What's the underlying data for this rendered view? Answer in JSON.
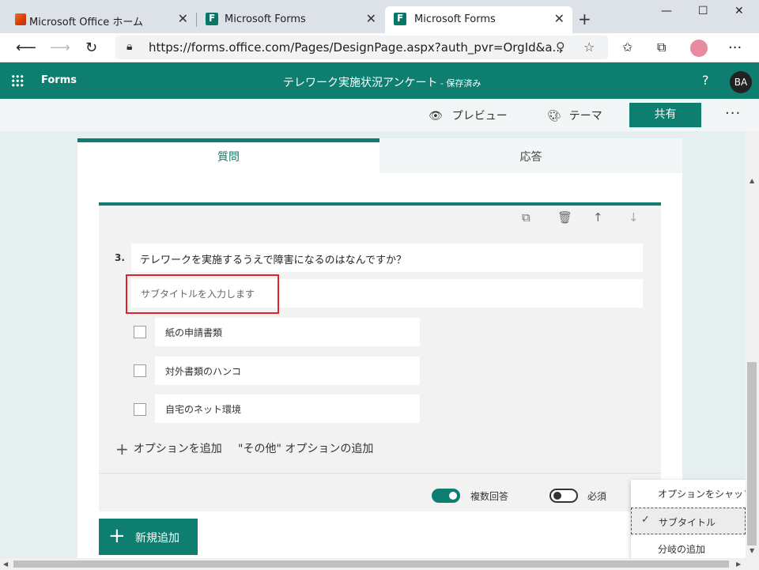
{
  "browser": {
    "tabs": [
      {
        "title": "Microsoft Office ホーム",
        "close": "✕"
      },
      {
        "title": "Microsoft Forms",
        "close": "✕"
      },
      {
        "title": "Microsoft Forms",
        "close": "✕"
      }
    ],
    "new_tab": "+",
    "window_controls": {
      "minimize": "—",
      "maximize": "☐",
      "close": "✕"
    },
    "url": "https://forms.office.com/Pages/DesignPage.aspx?auth_pvr=OrgId&a..."
  },
  "forms_header": {
    "app_name": "Forms",
    "doc_title": "テレワーク実施状況アンケート",
    "saved_status": " - 保存済み",
    "help": "?",
    "avatar": "BA"
  },
  "commands": {
    "preview": "プレビュー",
    "theme": "テーマ",
    "share": "共有",
    "more": "···"
  },
  "tabs": {
    "questions": "質問",
    "responses": "応答"
  },
  "question": {
    "number": "3.",
    "title": "テレワークを実施するうえで障害になるのはなんですか？",
    "subtitle_placeholder": "サブタイトルを入力します",
    "options": [
      "紙の申請書類",
      "対外書類のハンコ",
      "自宅のネット環境"
    ],
    "add_option": "オプションを追加",
    "add_other_option": "\"その他\" オプションの追加",
    "multiple_answers": {
      "label": "複数回答",
      "on": true
    },
    "required": {
      "label": "必須",
      "on": false
    }
  },
  "new_question": "新規追加",
  "menu": {
    "items": [
      {
        "label": "オプションをシャッフル",
        "checked": false
      },
      {
        "label": "サブタイトル",
        "checked": true
      },
      {
        "label": "分岐の追加",
        "checked": false
      }
    ]
  },
  "colors": {
    "accent": "#0d7e6f",
    "highlight_border": "#e0232a"
  }
}
